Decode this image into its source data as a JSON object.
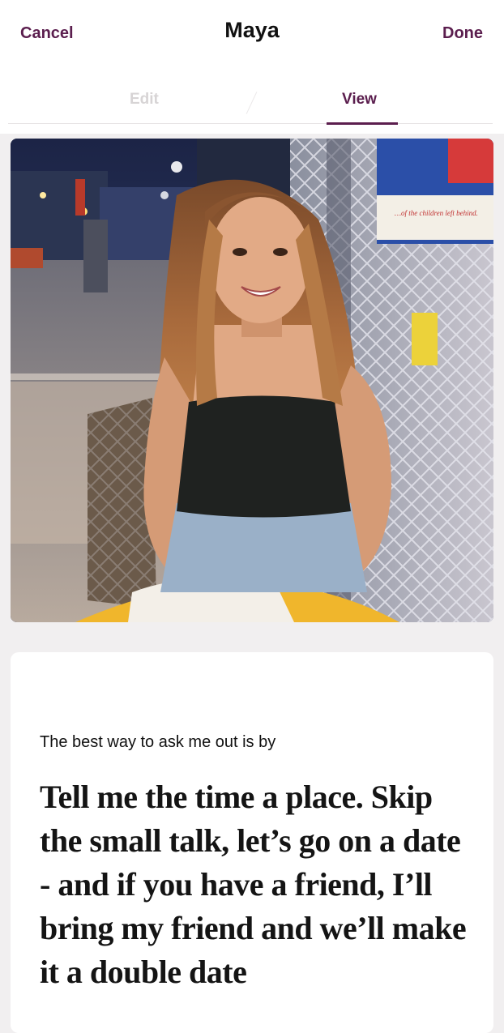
{
  "header": {
    "cancel_label": "Cancel",
    "title": "Maya",
    "done_label": "Done"
  },
  "tabs": [
    {
      "label": "Edit",
      "active": false
    },
    {
      "label": "View",
      "active": true
    }
  ],
  "photo": {
    "description_icon": "profile-photo",
    "sign_text": "…of the children left behind."
  },
  "prompt": {
    "label": "The best way to ask me out is by",
    "answer": "Tell me the time a place. Skip the small talk, let’s go on a date - and if you have a friend, I’ll bring my friend and we’ll make it a double date"
  },
  "colors": {
    "accent": "#5b1e4e",
    "inactive_tab": "#d7d4d5",
    "background": "#f1eff0",
    "card": "#ffffff"
  }
}
